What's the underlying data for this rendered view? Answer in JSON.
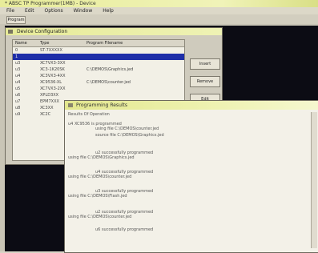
{
  "window": {
    "title": "* ABSC TP Programmer(1MB) - Device"
  },
  "menu": [
    "File",
    "Edit",
    "Options",
    "Window",
    "Help"
  ],
  "toolbar": {
    "btn": "Program"
  },
  "device_window": {
    "title": "Device Configuration",
    "columns": [
      "Name",
      "Type",
      "Program Filename"
    ],
    "rows": [
      {
        "n": "0",
        "t": "ST-7XXXXX",
        "f": ""
      },
      {
        "n": "1",
        "t": "",
        "f": "",
        "sel": true
      },
      {
        "n": "u3",
        "t": "XC7VX3-3XX",
        "f": ""
      },
      {
        "n": "u3",
        "t": "XC3-1K20SK",
        "f": "C:\\DEMOS\\Graphics.jed"
      },
      {
        "n": "u4",
        "t": "XC3VX3-4XX",
        "f": ""
      },
      {
        "n": "u4",
        "t": "XC9536-XL",
        "f": "C:\\DEMOS\\counter.jed"
      },
      {
        "n": "u5",
        "t": "XC7VX3-2XX",
        "f": ""
      },
      {
        "n": "u6",
        "t": "XPLD3XX",
        "f": ""
      },
      {
        "n": "u7",
        "t": "EPM7XXX",
        "f": ""
      },
      {
        "n": "u8",
        "t": "XC3XX",
        "f": ""
      },
      {
        "n": "u9",
        "t": "XC2C",
        "f": ""
      }
    ],
    "buttons": [
      "Insert",
      "Remove",
      "Edit"
    ]
  },
  "results_window": {
    "title": "Programming Results",
    "header": "Results Of Operation",
    "lines": [
      "u4 XC9536 is programmed",
      "using file C:\\DEMOS\\counter.jed",
      "source file C:\\DEMOS\\Graphics.jed",
      "u2 successfully programmed",
      "using file C:\\DEMOS\\Graphics.jed",
      "u4 successfully programmed",
      "using file C:\\DEMOS\\counter.jed",
      "u3 successfully programmed",
      "using file C:\\DEMOS\\Flash.jed",
      "u2 successfully programmed",
      "using file C:\\DEMOS\\counter.jed",
      "u6 successfully programmed"
    ]
  }
}
